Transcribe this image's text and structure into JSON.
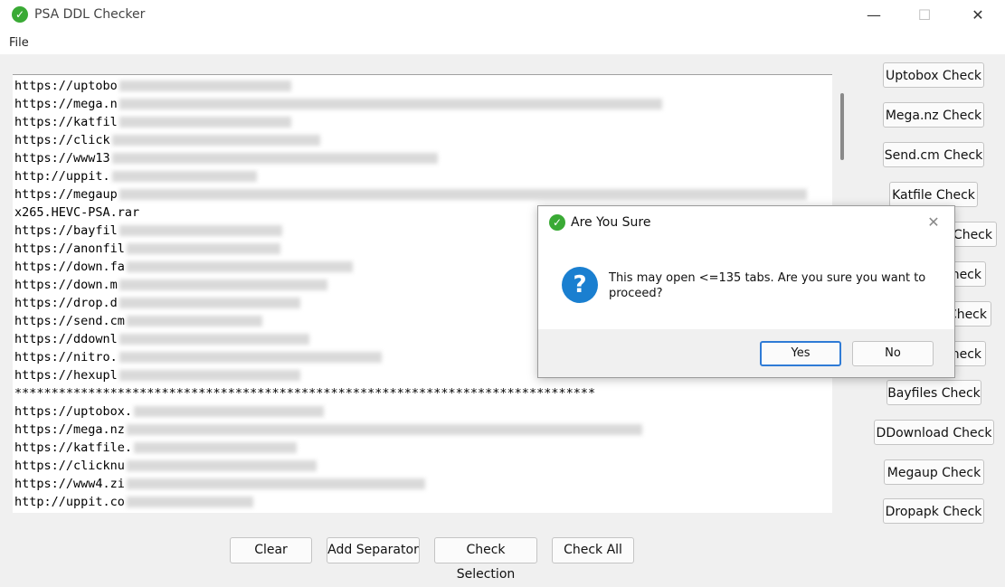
{
  "window": {
    "title": "PSA DDL Checker",
    "minimize_glyph": "—",
    "maximize_glyph": "☐",
    "close_glyph": "✕"
  },
  "menu": {
    "file": "File"
  },
  "links": [
    "https://uptobo",
    "https://mega.n",
    "https://katfil",
    "https://click",
    "https://www13",
    "http://uppit.",
    "https://megaup",
    "x265.HEVC-PSA.rar",
    "https://bayfil",
    "https://anonfil",
    "https://down.fa",
    "https://down.m",
    "https://drop.d",
    "https://send.cm",
    "https://ddownl",
    "https://nitro.",
    "https://hexupl",
    "*******************************************************************************",
    "https://uptobox.",
    "https://mega.nz",
    "https://katfile.",
    "https://clicknu",
    "https://www4.zi",
    "http://uppit.co"
  ],
  "side_buttons": [
    "Uptobox Check",
    "Mega.nz Check",
    "Send.cm Check",
    "Katfile Check",
    "Check",
    "Check",
    "Check",
    "heck",
    "Bayfiles Check",
    "DDownload Check",
    "Megaup Check",
    "Dropapk Check"
  ],
  "bottom_buttons": {
    "clear": "Clear",
    "add_separator": "Add Separator",
    "check_selection": "Check Selection",
    "check_all": "Check All"
  },
  "dialog": {
    "title": "Are You Sure",
    "message": "This may open <=135 tabs. Are you sure you want to proceed?",
    "yes": "Yes",
    "no": "No",
    "close_glyph": "✕",
    "icon": "question-icon"
  },
  "colors": {
    "accent": "#2f7bd6",
    "app_icon": "#3aaa35",
    "question_icon": "#1a7fd0"
  }
}
